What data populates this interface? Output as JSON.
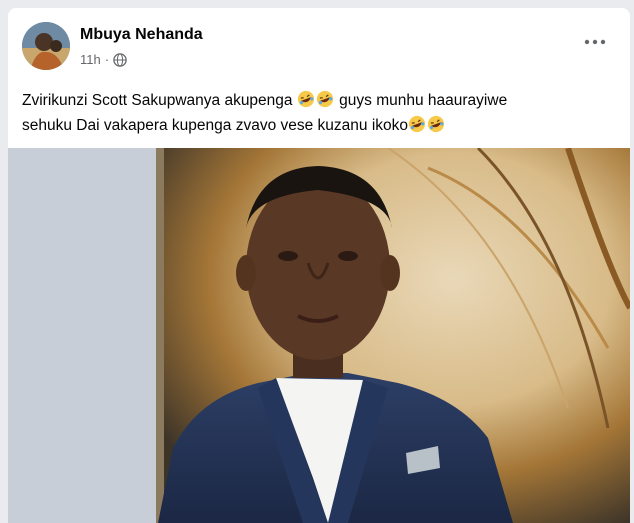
{
  "post": {
    "author": "Mbuya Nehanda",
    "timestamp": "11h",
    "separator": "·",
    "text_line1": "Zvirikunzi Scott Sakupwanya akupenga",
    "text_line1b": "guys munhu haaurayiwe",
    "text_line2": "sehuku Dai vakapera kupenga zvavo vese kuzanu ikoko",
    "emoji": "rolling-on-floor-laughing",
    "audience_icon": "globe-icon",
    "more_icon": "more-options-icon"
  },
  "colors": {
    "card": "#ffffff",
    "page_bg": "#e9ebee",
    "text": "#050505",
    "secondary_text": "#65676b"
  }
}
